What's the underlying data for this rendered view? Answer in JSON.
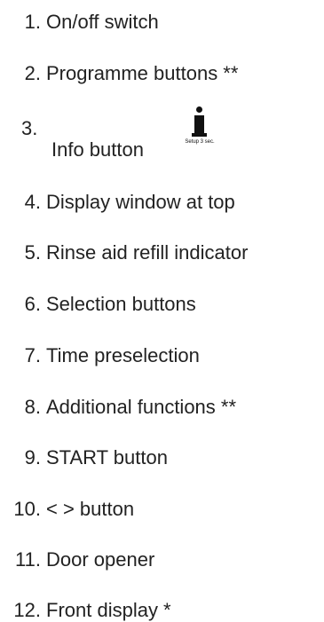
{
  "items": [
    {
      "num": "1.",
      "text": "On/off switch"
    },
    {
      "num": "2.",
      "text": "Programme buttons **"
    },
    {
      "num": "3.",
      "text": "Info button",
      "icon": "info-i-icon",
      "icon_caption": "Setup 3 sec."
    },
    {
      "num": "4.",
      "text": "Display window at top"
    },
    {
      "num": "5.",
      "text": "Rinse aid refill indicator"
    },
    {
      "num": "6.",
      "text": "Selection buttons"
    },
    {
      "num": "7.",
      "text": "Time preselection"
    },
    {
      "num": "8.",
      "text": "Additional functions **"
    },
    {
      "num": "9.",
      "text": "START button"
    },
    {
      "num": "10.",
      "text": "< > button"
    },
    {
      "num": "11.",
      "text": "Door opener"
    },
    {
      "num": "12.",
      "text": "Front display *"
    }
  ]
}
